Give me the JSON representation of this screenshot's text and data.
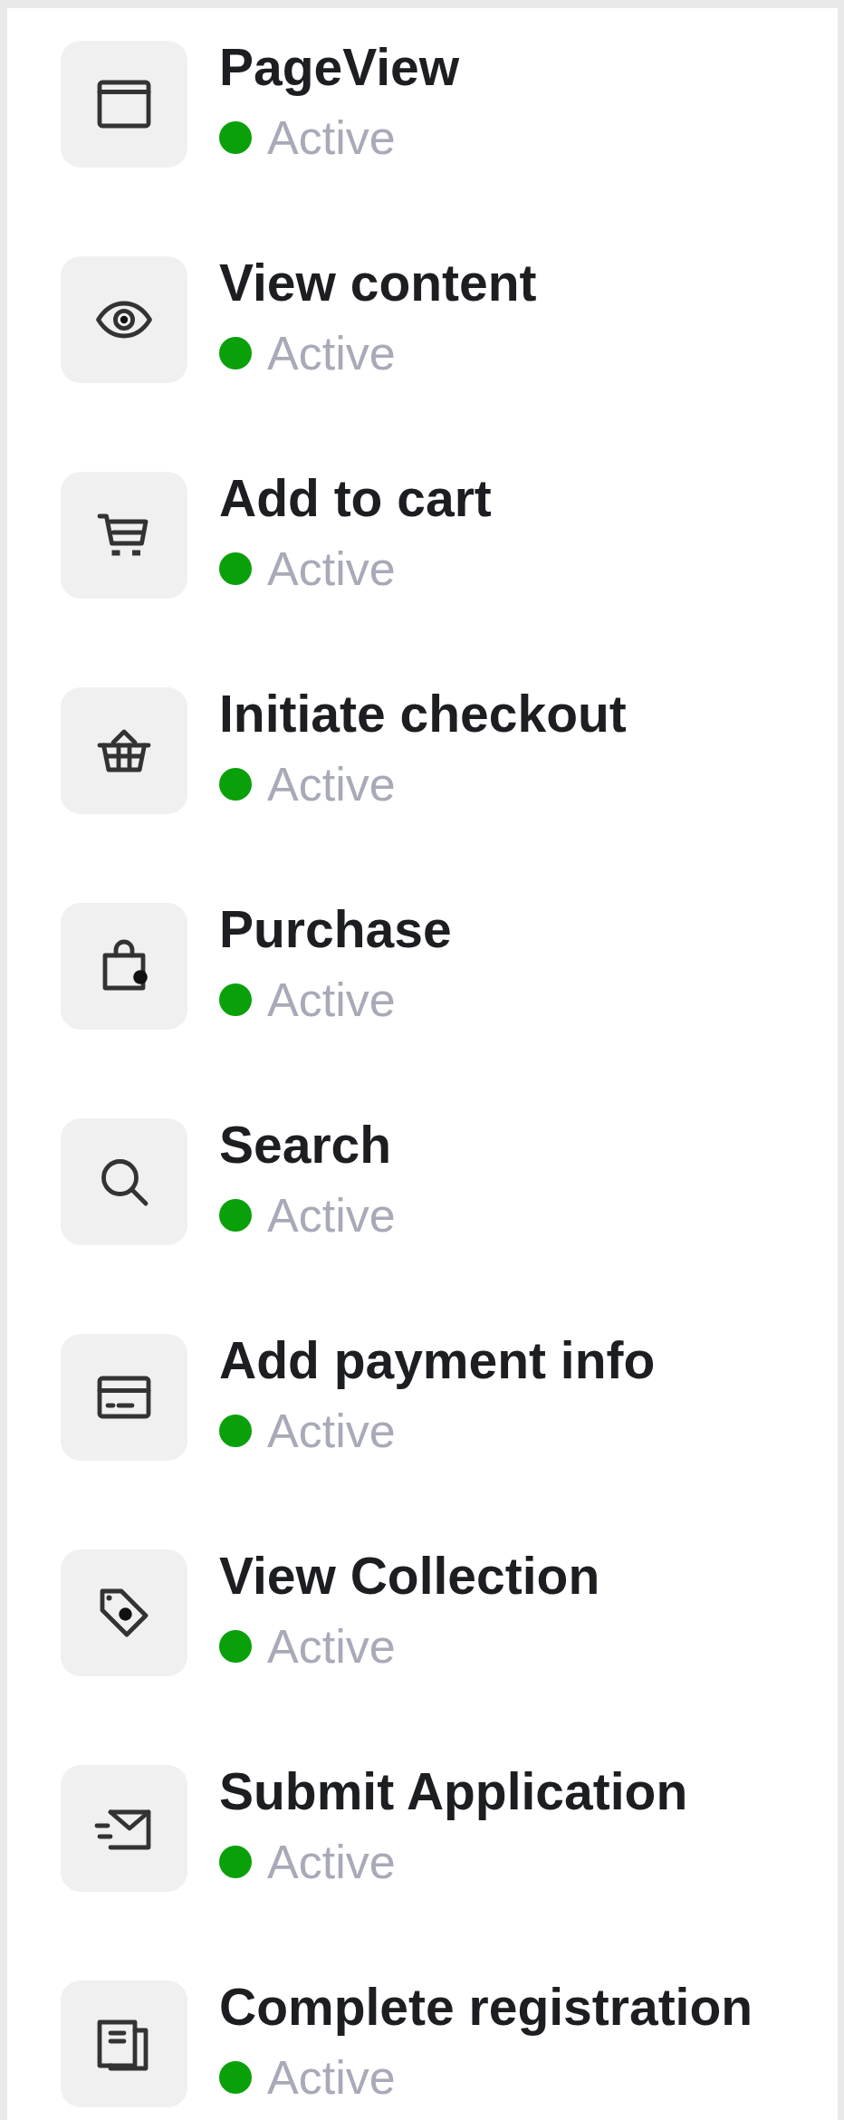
{
  "events": [
    {
      "name": "PageView",
      "kind": "window",
      "status": "Active",
      "color": "#0aa00a"
    },
    {
      "name": "View content",
      "kind": "eye",
      "status": "Active",
      "color": "#0aa00a"
    },
    {
      "name": "Add to cart",
      "kind": "cart",
      "status": "Active",
      "color": "#0aa00a"
    },
    {
      "name": "Initiate checkout",
      "kind": "basket",
      "status": "Active",
      "color": "#0aa00a"
    },
    {
      "name": "Purchase",
      "kind": "bag",
      "status": "Active",
      "color": "#0aa00a"
    },
    {
      "name": "Search",
      "kind": "search",
      "status": "Active",
      "color": "#0aa00a"
    },
    {
      "name": "Add payment info",
      "kind": "card",
      "status": "Active",
      "color": "#0aa00a"
    },
    {
      "name": "View Collection",
      "kind": "tag",
      "status": "Active",
      "color": "#0aa00a"
    },
    {
      "name": "Submit Application",
      "kind": "mail",
      "status": "Active",
      "color": "#0aa00a"
    },
    {
      "name": "Complete registration",
      "kind": "form",
      "status": "Active",
      "color": "#0aa00a"
    }
  ]
}
